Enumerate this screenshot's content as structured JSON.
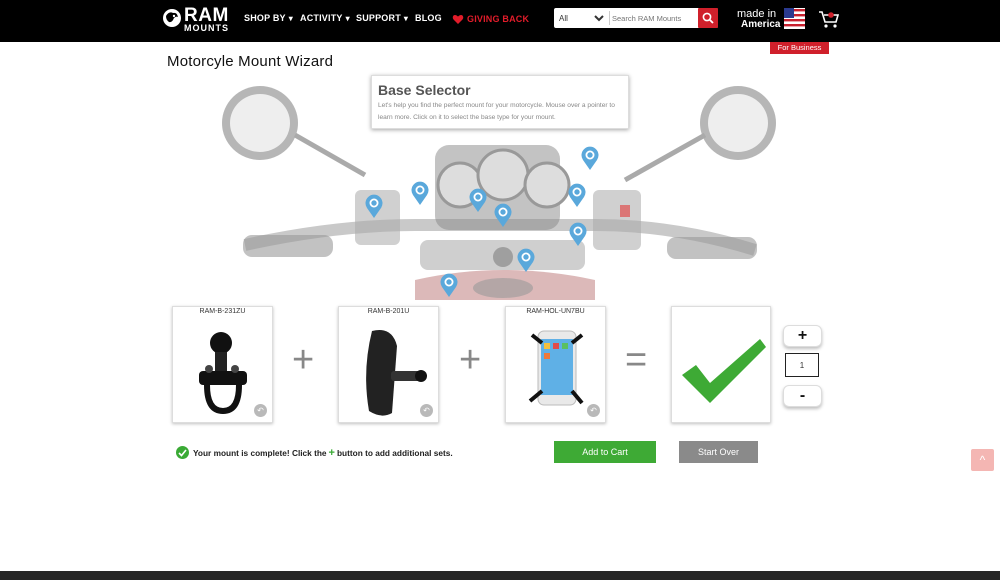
{
  "header": {
    "logo_big": "RAM",
    "logo_small": "MOUNTS",
    "nav": [
      {
        "label": "SHOP BY",
        "dropdown": true
      },
      {
        "label": "ACTIVITY",
        "dropdown": true
      },
      {
        "label": "SUPPORT",
        "dropdown": true
      },
      {
        "label": "BLOG",
        "dropdown": false
      },
      {
        "label": "GIVING BACK",
        "dropdown": false
      }
    ],
    "search": {
      "category": "All",
      "placeholder": "Search RAM Mounts"
    },
    "made_line1": "made in",
    "made_line2": "America",
    "business_label": "For Business"
  },
  "wizard": {
    "title": "Motorcyle Mount Wizard",
    "tooltip_title": "Base Selector",
    "tooltip_text": "Let's help you find the perfect mount for your motorcycle. Mouse over a pointer to learn more. Click on it to select the base type for your mount.",
    "parts": [
      {
        "sku": "RAM-B-231ZU"
      },
      {
        "sku": "RAM-B-201U"
      },
      {
        "sku": "RAM-HOL-UN7BU"
      }
    ],
    "plus_sign": "+",
    "equals_sign": "=",
    "quantity": "1",
    "qty_plus": "+",
    "qty_minus": "-",
    "status_before": "Your mount is complete! Click the",
    "status_plus": "+",
    "status_after": "button to add additional sets.",
    "add_to_cart": "Add to Cart",
    "start_over": "Start Over",
    "back_to_top": "^"
  },
  "colors": {
    "brand_red": "#d0202b",
    "success_green": "#3eaa35",
    "pin_blue": "#5aa8db"
  }
}
